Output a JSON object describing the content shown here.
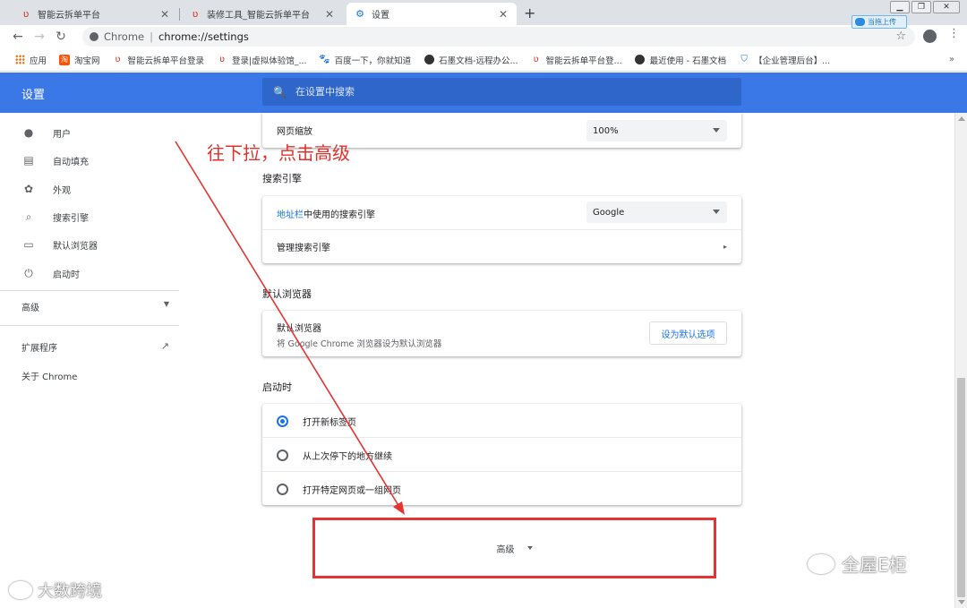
{
  "tabs": [
    {
      "title": "智能云拆单平台",
      "favicon": "red-logo-icon"
    },
    {
      "title": "装修工具_智能云拆单平台",
      "favicon": "red-logo-icon"
    },
    {
      "title": "设置",
      "favicon": "gear-icon",
      "active": true
    }
  ],
  "upload_badge": "当拖上传",
  "omnibox": {
    "chip": "Chrome",
    "url": "chrome://settings"
  },
  "bookmarks": [
    {
      "label": "应用",
      "icon": "apps-icon"
    },
    {
      "label": "淘宝网",
      "icon": "taobao-icon"
    },
    {
      "label": "智能云拆单平台登录",
      "icon": "red-logo-icon"
    },
    {
      "label": "登录|虚拟体验馆_...",
      "icon": "red-logo-icon"
    },
    {
      "label": "百度一下，你就知道",
      "icon": "baidu-icon"
    },
    {
      "label": "石墨文档-远程办公...",
      "icon": "shimo-icon"
    },
    {
      "label": "智能云拆单平台登...",
      "icon": "red-logo-icon"
    },
    {
      "label": "最近使用 - 石墨文档",
      "icon": "shimo-icon"
    },
    {
      "label": "【企业管理后台】...",
      "icon": "shield-icon"
    }
  ],
  "settings": {
    "title": "设置",
    "search_placeholder": "在设置中搜索"
  },
  "sidebar": {
    "items": [
      {
        "label": "用户",
        "icon": "person-icon"
      },
      {
        "label": "自动填充",
        "icon": "clipboard-icon"
      },
      {
        "label": "外观",
        "icon": "palette-icon"
      },
      {
        "label": "搜索引擎",
        "icon": "search-icon"
      },
      {
        "label": "默认浏览器",
        "icon": "browser-icon"
      },
      {
        "label": "启动时",
        "icon": "power-icon"
      }
    ],
    "advanced": "高级",
    "extensions": "扩展程序",
    "about": "关于 Chrome"
  },
  "appearance": {
    "zoom_label": "网页缩放",
    "zoom_value": "100%"
  },
  "search_engine": {
    "section_title": "搜索引擎",
    "address_bar_link": "地址栏",
    "address_bar_rest": "中使用的搜索引擎",
    "engine_value": "Google",
    "manage_label": "管理搜索引擎"
  },
  "default_browser": {
    "section_title": "默认浏览器",
    "label": "默认浏览器",
    "sublabel": "将 Google Chrome 浏览器设为默认浏览器",
    "button": "设为默认选项"
  },
  "startup": {
    "section_title": "启动时",
    "options": [
      {
        "label": "打开新标签页",
        "checked": true
      },
      {
        "label": "从上次停下的地方继续",
        "checked": false
      },
      {
        "label": "打开特定网页或一组网页",
        "checked": false
      }
    ]
  },
  "advanced_button": "高级",
  "annotation": "往下拉，点击高级",
  "watermarks": {
    "left": "大数跨境",
    "right": "全屋E柜"
  },
  "colors": {
    "header_blue": "#3b78e7",
    "annotation_red": "#e53333",
    "link_blue": "#1a73e8"
  }
}
